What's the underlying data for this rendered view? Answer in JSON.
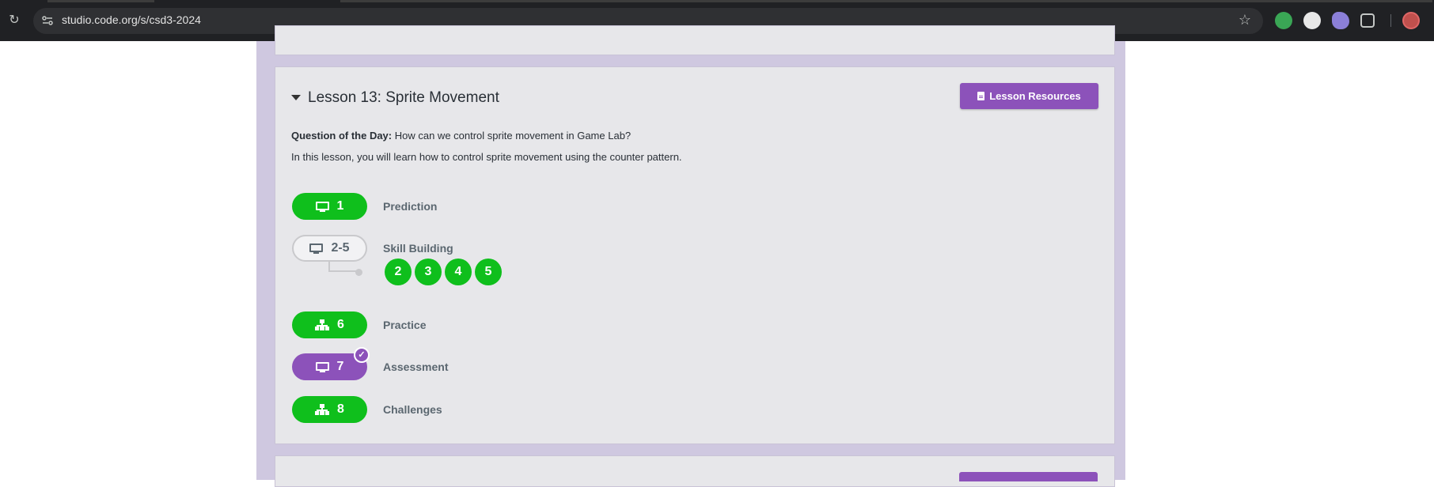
{
  "browser": {
    "url": "studio.code.org/s/csd3-2024",
    "icons": [
      "reload-icon",
      "site-info-icon",
      "bookmark-star-icon",
      "extension-icon",
      "profile-avatar"
    ]
  },
  "lesson": {
    "title": "Lesson 13: Sprite Movement",
    "resources_label": "Lesson Resources",
    "qotd_label": "Question of the Day:",
    "qotd_text": " How can we control sprite movement in Game Lab?",
    "description": "In this lesson, you will learn how to control sprite movement using the counter pattern."
  },
  "levels": [
    {
      "number": "1",
      "label": "Prediction",
      "icon": "monitor-icon",
      "status": "completed"
    },
    {
      "number": "2-5",
      "label": "Skill Building",
      "icon": "monitor-icon",
      "status": "group"
    },
    {
      "number": "6",
      "label": "Practice",
      "icon": "sitemap-icon",
      "status": "completed"
    },
    {
      "number": "7",
      "label": "Assessment",
      "icon": "monitor-icon",
      "status": "submitted"
    },
    {
      "number": "8",
      "label": "Challenges",
      "icon": "sitemap-icon",
      "status": "completed"
    }
  ],
  "sublevels": [
    "2",
    "3",
    "4",
    "5"
  ],
  "colors": {
    "completed": "#0fbf1c",
    "submitted": "#8c52ba",
    "unit_background": "#cfc8e0",
    "card_background": "#e7e7ea"
  }
}
